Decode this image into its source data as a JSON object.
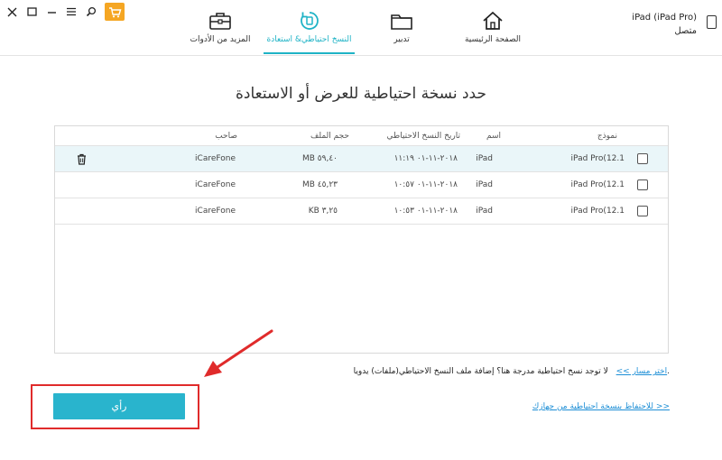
{
  "window_controls": {
    "close": "✕",
    "restore": "☐",
    "minimize": "—",
    "menu": "☰",
    "feedback": "⚲"
  },
  "nav": {
    "home": "الصفحة الرئيسية",
    "manage": "تدبير",
    "backup_restore": "النسخ احتياطي& استعادة",
    "more_tools": "المزيد من الأدوات"
  },
  "device": {
    "name": "iPad (iPad Pro)",
    "status": "متصل"
  },
  "page_title": "حدد نسخة احتياطية للعرض أو الاستعادة",
  "table": {
    "headers": {
      "model": "نموذج",
      "name": "اسم",
      "date": "تاريخ النسخ الاحتياطي",
      "size": "حجم الملف",
      "owner": "صاحب"
    },
    "rows": [
      {
        "model": "iPad Pro(12.1",
        "name": "iPad",
        "date": "٢٠١٨-١١-٠١ ١١:١٩",
        "size": "MB ٥٩,٤٠",
        "owner": "iCareFone"
      },
      {
        "model": "iPad Pro(12.1",
        "name": "iPad",
        "date": "٢٠١٨-١١-٠١ ١٠:٥٧",
        "size": "MB ٤٥,٢٣",
        "owner": "iCareFone"
      },
      {
        "model": "iPad Pro(12.1",
        "name": "iPad",
        "date": "٢٠١٨-١١-٠١ ١٠:٥٣",
        "size": "KB ٣,٢٥",
        "owner": "iCareFone"
      }
    ]
  },
  "notice": {
    "text": "لا توجد نسخ احتياطية مدرجة هنا؟ إضافة ملف النسخ الاحتياطي(ملفات) يدويا.",
    "link": "اختر مسار >>"
  },
  "save_link": "للاحتفاظ بنسخة احتياطية من جهازك >>",
  "view_button": "رأي",
  "colors": {
    "accent": "#29b4cd",
    "link": "#1e8fd6",
    "annotation": "#e02b2b",
    "selected_row": "#eaf6f9",
    "cart": "#f5a623"
  }
}
